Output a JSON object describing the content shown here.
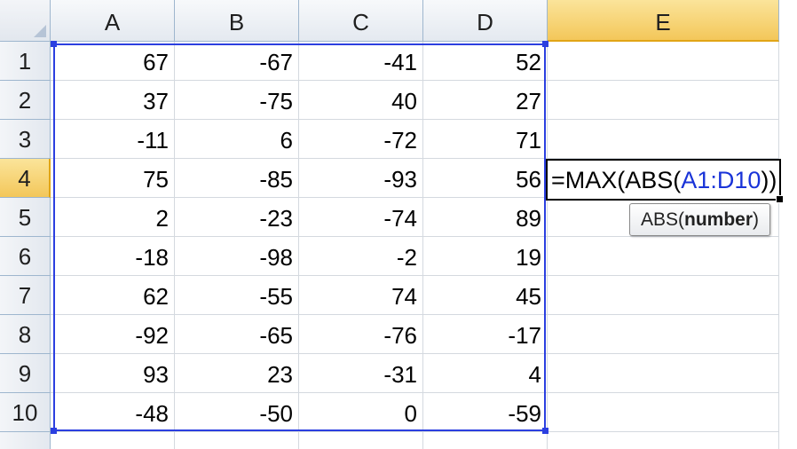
{
  "columns": [
    {
      "label": "A",
      "active": false
    },
    {
      "label": "B",
      "active": false
    },
    {
      "label": "C",
      "active": false
    },
    {
      "label": "D",
      "active": false
    },
    {
      "label": "E",
      "active": true
    }
  ],
  "rows": [
    {
      "label": "1",
      "values": [
        "67",
        "-67",
        "-41",
        "52"
      ]
    },
    {
      "label": "2",
      "values": [
        "37",
        "-75",
        "40",
        "27"
      ]
    },
    {
      "label": "3",
      "values": [
        "-11",
        "6",
        "-72",
        "71"
      ]
    },
    {
      "label": "4",
      "values": [
        "75",
        "-85",
        "-93",
        "56"
      ]
    },
    {
      "label": "5",
      "values": [
        "2",
        "-23",
        "-74",
        "89"
      ]
    },
    {
      "label": "6",
      "values": [
        "-18",
        "-98",
        "-2",
        "19"
      ]
    },
    {
      "label": "7",
      "values": [
        "62",
        "-55",
        "74",
        "45"
      ]
    },
    {
      "label": "8",
      "values": [
        "-92",
        "-65",
        "-76",
        "-17"
      ]
    },
    {
      "label": "9",
      "values": [
        "93",
        "23",
        "-31",
        "4"
      ]
    },
    {
      "label": "10",
      "values": [
        "-48",
        "-50",
        "0",
        "-59"
      ]
    }
  ],
  "active_row_label": "4",
  "formula": {
    "prefix": "=MAX(ABS(",
    "ref": "A1:D10",
    "suffix": "))"
  },
  "tooltip": {
    "func": "ABS(",
    "arg": "number",
    "close": ")"
  },
  "colors": {
    "range_border": "#2b3fe0",
    "active_header": "#f3c75a",
    "header_border": "#9eb6ce",
    "gridline": "#d4d9df"
  }
}
